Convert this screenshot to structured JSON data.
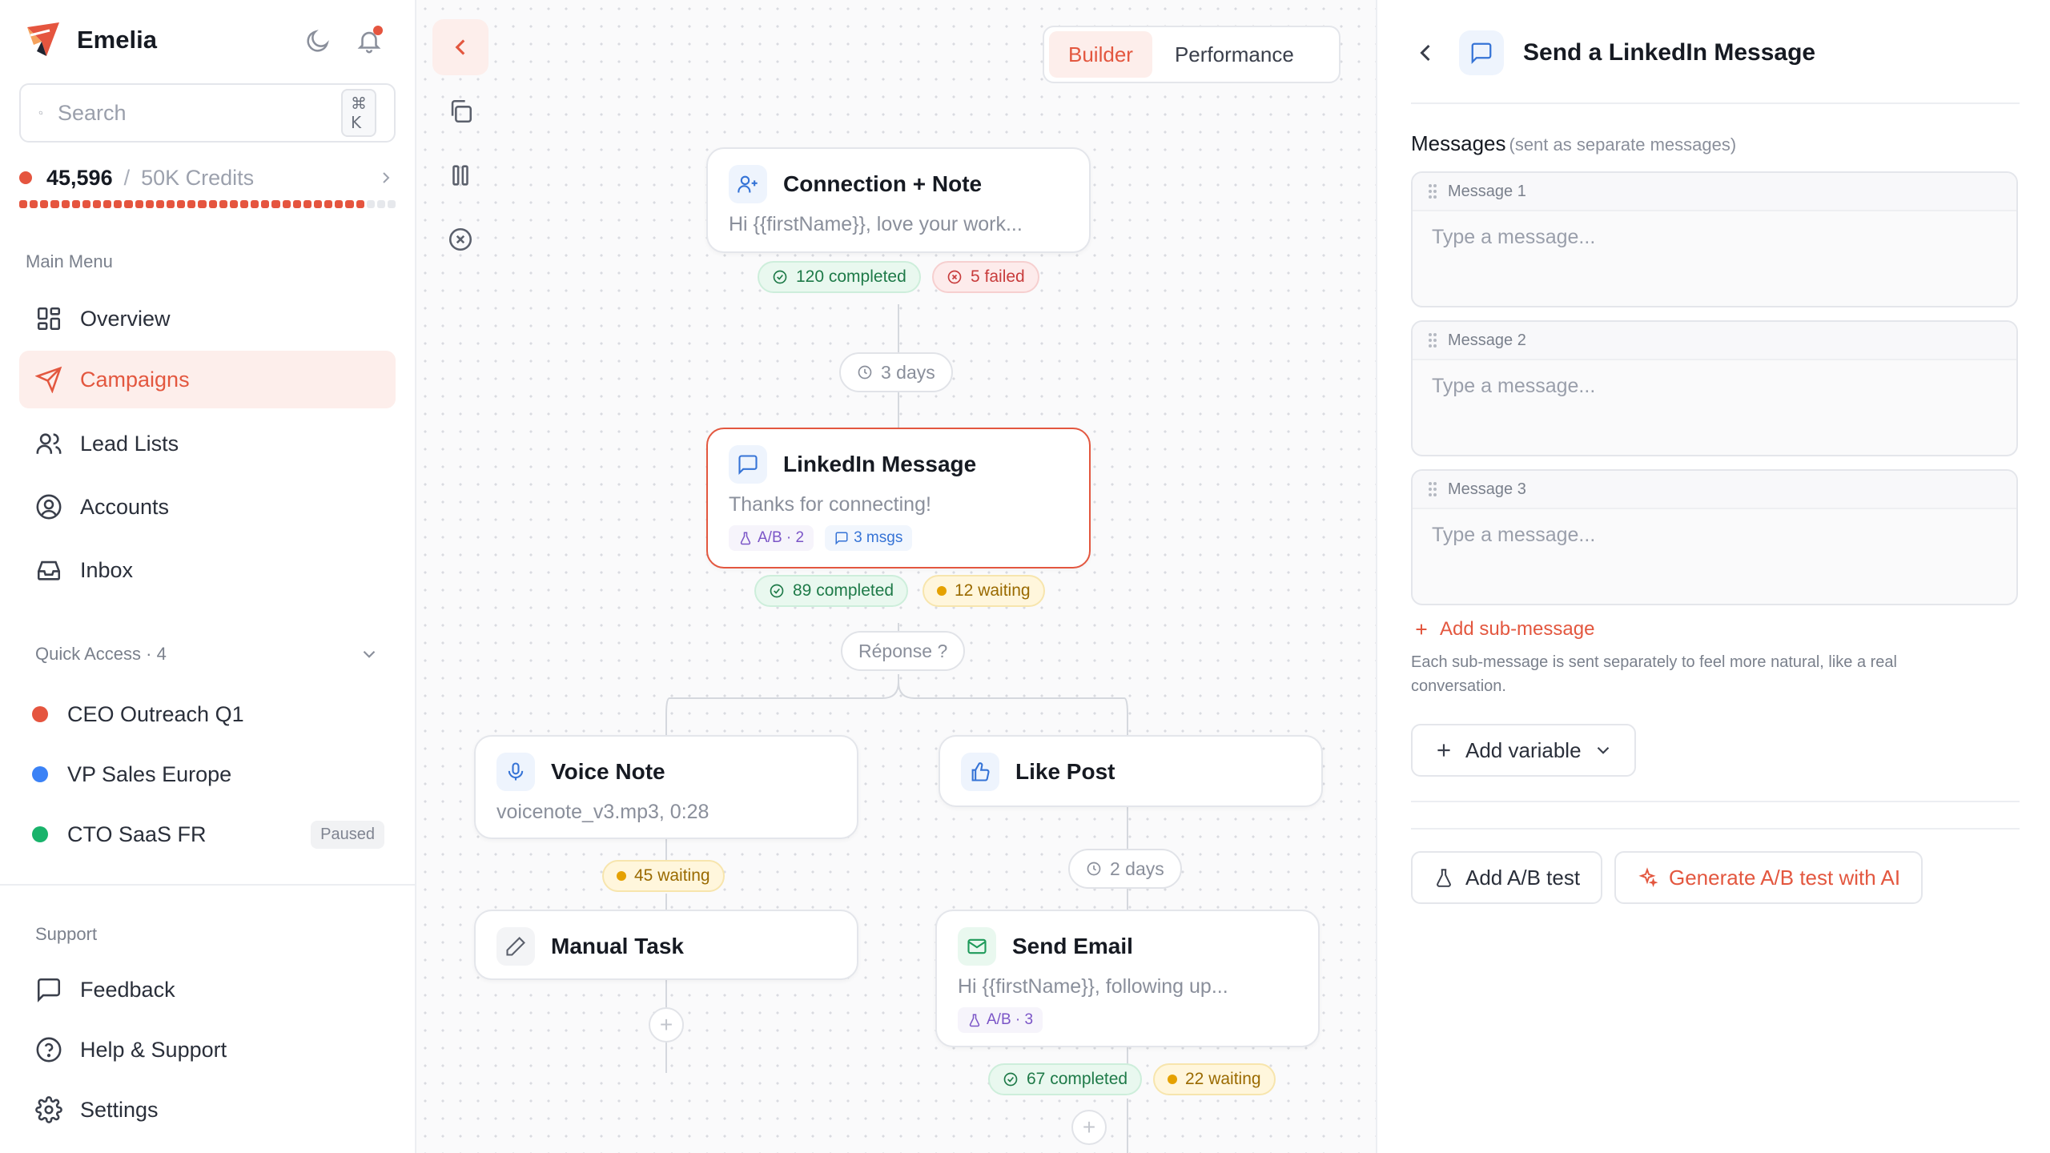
{
  "brand": {
    "name": "Emelia"
  },
  "icons": {
    "theme_toggle": "moon-icon",
    "notifications": "bell-icon"
  },
  "search": {
    "placeholder": "Search",
    "shortcut": "⌘ K"
  },
  "credits": {
    "used": "45,596",
    "separator": "/",
    "total": "50K Credits",
    "fraction_used": 0.9119
  },
  "main_menu": {
    "title": "Main Menu",
    "items": [
      {
        "label": "Overview",
        "icon": "grid-icon",
        "active": false
      },
      {
        "label": "Campaigns",
        "icon": "send-icon",
        "active": true
      },
      {
        "label": "Lead Lists",
        "icon": "users-icon",
        "active": false
      },
      {
        "label": "Accounts",
        "icon": "user-circle-icon",
        "active": false
      },
      {
        "label": "Inbox",
        "icon": "inbox-icon",
        "active": false
      }
    ]
  },
  "quick_access": {
    "title": "Quick Access · 4",
    "items": [
      {
        "label": "CEO Outreach Q1",
        "color": "#e5553f",
        "badge": ""
      },
      {
        "label": "VP Sales Europe",
        "color": "#3b82f6",
        "badge": ""
      },
      {
        "label": "CTO SaaS FR",
        "color": "#19b36b",
        "badge": "Paused"
      }
    ]
  },
  "support": {
    "title": "Support",
    "items": [
      {
        "label": "Feedback",
        "icon": "message-square-icon"
      },
      {
        "label": "Help & Support",
        "icon": "help-circle-icon"
      },
      {
        "label": "Settings",
        "icon": "gear-icon"
      }
    ]
  },
  "toolbar": {
    "tools": [
      "chevron-left-icon",
      "copy-icon",
      "pause-icon",
      "x-circle-icon"
    ]
  },
  "view_toggle": {
    "builder": "Builder",
    "performance": "Performance",
    "active": "Builder"
  },
  "flow": {
    "connection": {
      "title": "Connection + Note",
      "preview": "Hi {{firstName}}, love your work...",
      "completed": "120 completed",
      "failed": "5 failed"
    },
    "delay1": "3 days",
    "linkedin": {
      "title": "LinkedIn Message",
      "preview": "Thanks for connecting!",
      "ab": "A/B · 2",
      "msgs": "3 msgs",
      "completed": "89 completed",
      "waiting": "12 waiting"
    },
    "branch": "Réponse ?",
    "voice": {
      "title": "Voice Note",
      "preview": "voicenote_v3.mp3, 0:28",
      "waiting": "45 waiting"
    },
    "like": {
      "title": "Like Post"
    },
    "delay2": "2 days",
    "manual": {
      "title": "Manual Task"
    },
    "email": {
      "title": "Send Email",
      "preview": "Hi {{firstName}}, following up...",
      "ab": "A/B · 3",
      "completed": "67 completed",
      "waiting": "22 waiting"
    }
  },
  "panel": {
    "title": "Send a LinkedIn Message",
    "messages_label": "Messages",
    "messages_hint": "(sent as separate messages)",
    "messages": [
      {
        "label": "Message 1",
        "placeholder": "Type a message..."
      },
      {
        "label": "Message 2",
        "placeholder": "Type a message..."
      },
      {
        "label": "Message 3",
        "placeholder": "Type a message..."
      }
    ],
    "add_sub": "Add sub-message",
    "add_sub_note": "Each sub-message is sent separately to feel more natural, like a real conversation.",
    "add_variable": "Add variable",
    "add_ab": "Add A/B test",
    "generate_ab": "Generate A/B test with AI"
  },
  "colors": {
    "accent": "#e3573f",
    "success": "#1e7a48",
    "danger": "#c83c3c",
    "warning": "#9a6a00"
  }
}
